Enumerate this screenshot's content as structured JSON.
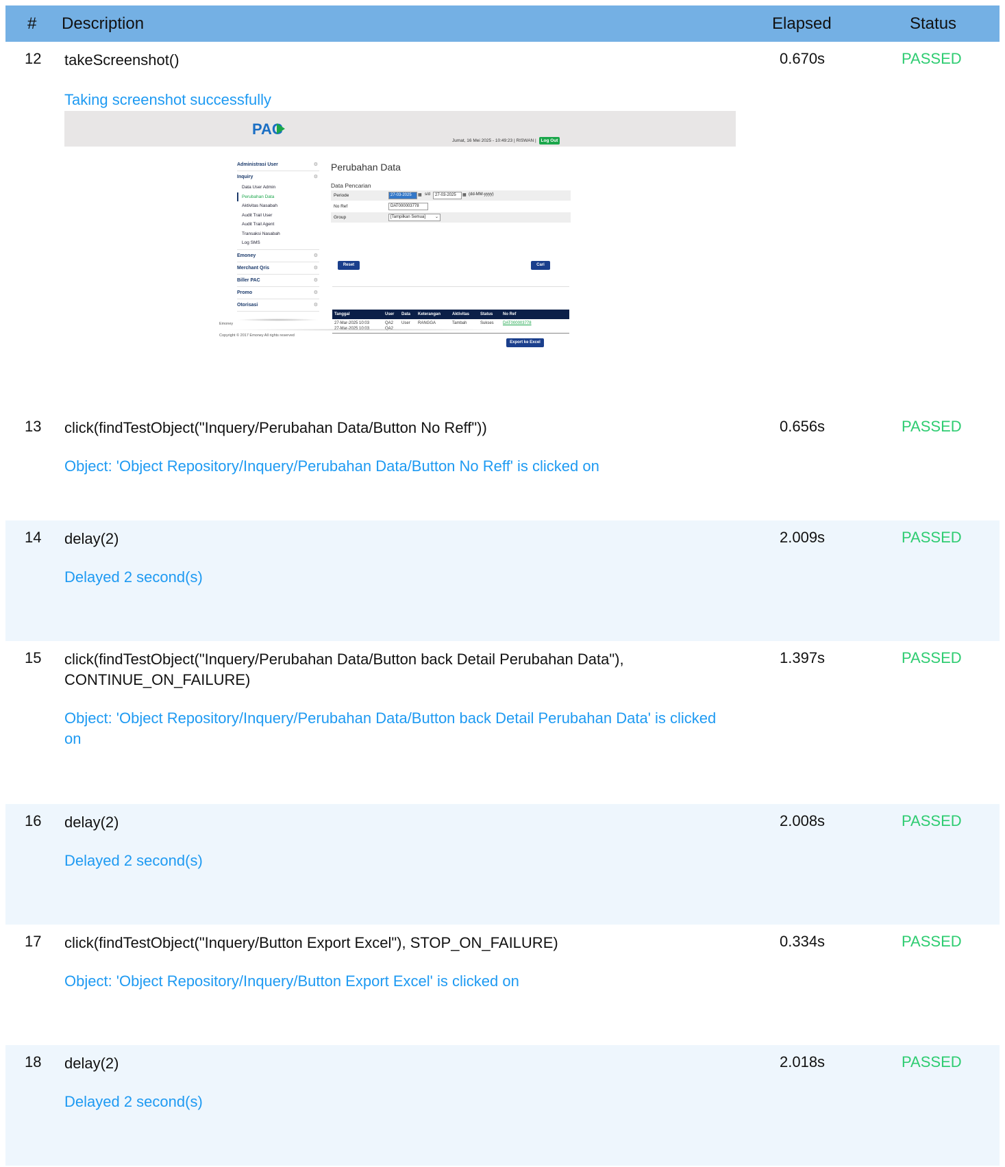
{
  "header": {
    "num": "#",
    "description": "Description",
    "elapsed": "Elapsed",
    "status": "Status"
  },
  "steps": [
    {
      "num": "12",
      "desc": "takeScreenshot()",
      "elapsed": "0.670s",
      "status": "PASSED",
      "msg": "Taking screenshot successfully"
    },
    {
      "num": "13",
      "desc": "click(findTestObject(\"Inquery/Perubahan Data/Button No Reff\"))",
      "elapsed": "0.656s",
      "status": "PASSED",
      "msg": "Object: 'Object Repository/Inquery/Perubahan Data/Button No Reff' is clicked on"
    },
    {
      "num": "14",
      "desc": "delay(2)",
      "elapsed": "2.009s",
      "status": "PASSED",
      "msg": "Delayed 2 second(s)"
    },
    {
      "num": "15",
      "desc": "click(findTestObject(\"Inquery/Perubahan Data/Button back Detail Perubahan Data\"), CONTINUE_ON_FAILURE)",
      "elapsed": "1.397s",
      "status": "PASSED",
      "msg": "Object: 'Object Repository/Inquery/Perubahan Data/Button back Detail Perubahan Data' is clicked on"
    },
    {
      "num": "16",
      "desc": "delay(2)",
      "elapsed": "2.008s",
      "status": "PASSED",
      "msg": "Delayed 2 second(s)"
    },
    {
      "num": "17",
      "desc": "click(findTestObject(\"Inquery/Button Export Excel\"), STOP_ON_FAILURE)",
      "elapsed": "0.334s",
      "status": "PASSED",
      "msg": "Object: 'Object Repository/Inquery/Button Export Excel' is clicked on"
    },
    {
      "num": "18",
      "desc": "delay(2)",
      "elapsed": "2.018s",
      "status": "PASSED",
      "msg": "Delayed 2 second(s)"
    }
  ],
  "screenshot": {
    "logo": "PAC",
    "datebar": "Jumat, 16 Mei 2025 - 10:49:23 | RISWAN |",
    "logout": "Log Out",
    "menu": {
      "admin_user": "Administrasi User",
      "inquiry": "Inquiry",
      "inquiry_items": [
        "Data User Admin",
        "Perubahan Data",
        "Aktivitas Nasabah",
        "Audit Trail User",
        "Audit Trail Agent",
        "Transaksi Nasabah",
        "Log SMS"
      ],
      "emoney": "Emoney",
      "merchant": "Merchant Qris",
      "biller": "Biller PAC",
      "promo": "Promo",
      "otorisasi": "Otorisasi"
    },
    "title": "Perubahan Data",
    "search_title": "Data Pencarian",
    "periode_label": "Periode",
    "date_from": "27-03-2025",
    "sd": "s/d",
    "date_to": "27-03-2025",
    "date_hint": "(dd-MM-yyyy)",
    "noref_label": "No Ref",
    "noref_value": "DAT000003778",
    "group_label": "Group",
    "group_value": "[Tampilkan Semua]",
    "reset": "Reset",
    "cari": "Cari",
    "table": {
      "headers": [
        "Tanggal",
        "User",
        "Data",
        "Keterangan",
        "Aktivitas",
        "Status",
        "No Ref"
      ],
      "row1": [
        "27-Mar-2025 10:03",
        "QA2",
        "User",
        "RANGGA",
        "Tambah",
        "Sukses",
        "DAT000003778"
      ],
      "row2": [
        "27-Mar-2025 10:03",
        "QA2"
      ]
    },
    "export": "Export ke Excel",
    "footer1": "Emoney",
    "footer2": "Copyright © 2017 Emoney All rights reserved"
  }
}
